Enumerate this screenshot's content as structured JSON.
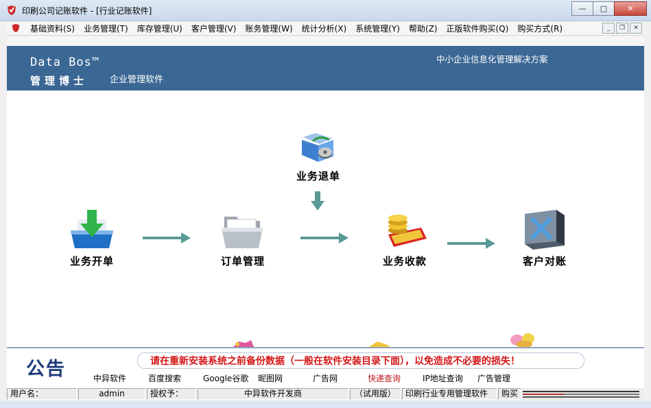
{
  "window": {
    "title": "印刷公司记账软件 - [行业记账软件]",
    "minimize_glyph": "—",
    "maximize_glyph": "□",
    "close_glyph": "✕"
  },
  "menu": {
    "items": [
      {
        "label": "基础资料(S)"
      },
      {
        "label": "业务管理(T)"
      },
      {
        "label": "库存管理(U)"
      },
      {
        "label": "客户管理(V)"
      },
      {
        "label": "账务管理(W)"
      },
      {
        "label": "统计分析(X)"
      },
      {
        "label": "系统管理(Y)"
      },
      {
        "label": "帮助(Z)"
      },
      {
        "label": "正版软件购买(Q)"
      },
      {
        "label": "购买方式(R)"
      }
    ],
    "mdi": {
      "minimize": "_",
      "restore": "❐",
      "close": "✕"
    }
  },
  "banner": {
    "brand_en": "Data Bos™",
    "brand_cn": "管理博士",
    "brand_sub": "企业管理软件",
    "slogan": "中小企业信息化管理解决方案"
  },
  "workflow": {
    "return": "业务退单",
    "open": "业务开单",
    "order": "订单管理",
    "collect": "业务收款",
    "reconcile": "客户对账"
  },
  "notice": {
    "title": "公告",
    "message": "请在重新安装系统之前备份数据（一般在软件安装目录下面），以免造成不必要的损失！",
    "links": [
      {
        "label": "中异软件",
        "color": "#000000"
      },
      {
        "label": "百度搜索",
        "color": "#000000"
      },
      {
        "label": "Google谷歌",
        "color": "#000000"
      },
      {
        "label": "昵图网",
        "color": "#000000"
      },
      {
        "label": "广告网",
        "color": "#000000"
      },
      {
        "label": "快递查询",
        "color": "#c01818"
      },
      {
        "label": "IP地址查询",
        "color": "#000000"
      },
      {
        "label": "广告管理",
        "color": "#000000"
      }
    ]
  },
  "status": {
    "user_label": "用户名：",
    "user_value": "admin",
    "license_label": "授权予：",
    "license_value": "中异软件开发商",
    "edition": "（试用版）",
    "product": "印刷行业专用管理软件",
    "buy": "购买"
  },
  "colors": {
    "banner": "#3b6794",
    "arrow": "#5a9a96",
    "notice_text": "#d41616",
    "notice_title": "#1c3b78"
  }
}
